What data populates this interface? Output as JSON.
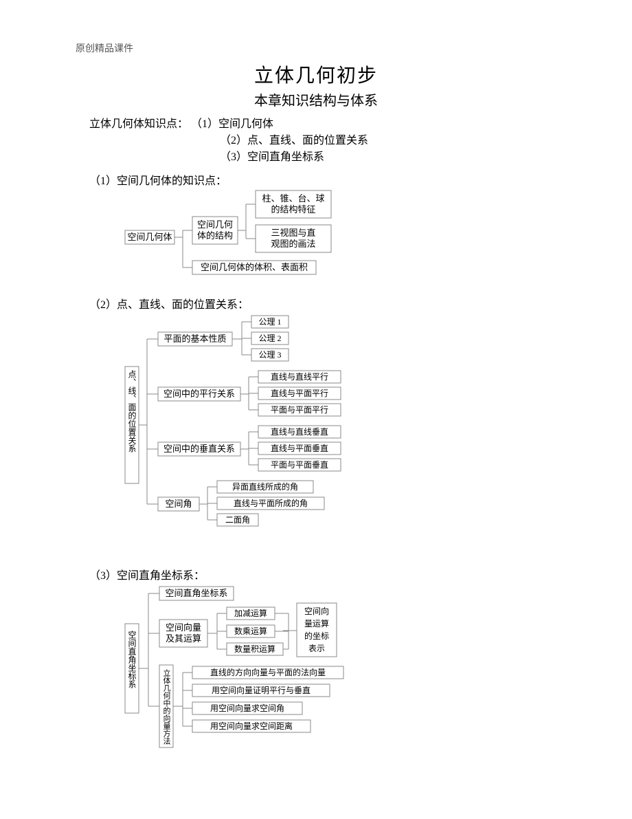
{
  "header": "原创精品课件",
  "title": "立体几何初步",
  "subtitle": "本章知识结构与体系",
  "intro": {
    "lead": "立体几何体知识点：",
    "i1": "（1）空间几何体",
    "i2": "（2）点、直线、面的位置关系",
    "i3": "（3）空间直角坐标系"
  },
  "s1": {
    "head": "（1）空间几何体的知识点：",
    "root": "空间几何体",
    "n1a": "空间几何",
    "n1b": "体的结构",
    "leaf1a": "柱、锥、台、球",
    "leaf1b": "的结构特征",
    "leaf2a": "三视图与直",
    "leaf2b": "观图的画法",
    "n2": "空间几何体的体积、表面积"
  },
  "s2": {
    "head": "（2）点、直线、面的位置关系：",
    "root": "点、线、面的位置关系",
    "b1": "平面的基本性质",
    "b1c1": "公理 1",
    "b1c2": "公理 2",
    "b1c3": "公理 3",
    "b2": "空间中的平行关系",
    "b2c1": "直线与直线平行",
    "b2c2": "直线与平面平行",
    "b2c3": "平面与平面平行",
    "b3": "空间中的垂直关系",
    "b3c1": "直线与直线垂直",
    "b3c2": "直线与平面垂直",
    "b3c3": "平面与平面垂直",
    "b4": "空间角",
    "b4c1": "异面直线所成的角",
    "b4c2": "直线与平面所成的角",
    "b4c3": "二面角"
  },
  "s3": {
    "head": "（3）空间直角坐标系：",
    "root": "空间直角坐标系",
    "t1": "空间直角坐标系",
    "t2a": "空间向量",
    "t2b": "及其运算",
    "t2c1": "加减运算",
    "t2c2": "数乘运算",
    "t2c3": "数量积运算",
    "t2r1": "空间向",
    "t2r2": "量运算",
    "t2r3": "的坐标",
    "t2r4": "表示",
    "t3": "立体几何中的向量方法",
    "t3c1": "直线的方向向量与平面的法向量",
    "t3c2": "用空间向量证明平行与垂直",
    "t3c3": "用空间向量求空间角",
    "t3c4": "用空间向量求空间距离"
  }
}
